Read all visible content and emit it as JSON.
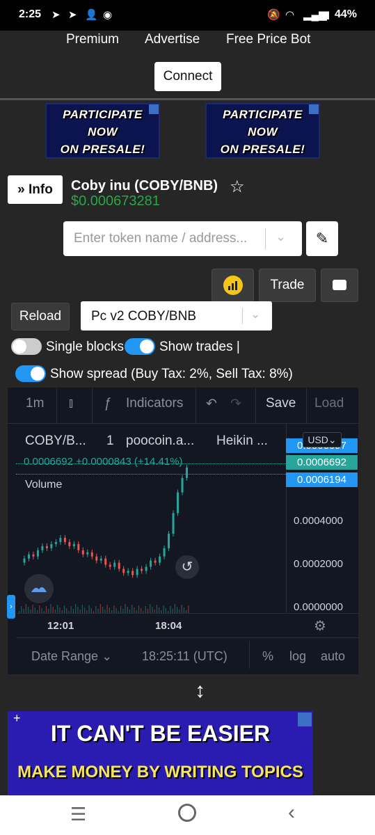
{
  "status_bar": {
    "time": "2:25",
    "battery": "44%"
  },
  "nav": {
    "premium": "Premium",
    "advertise": "Advertise",
    "free_price_bot": "Free Price Bot",
    "connect": "Connect"
  },
  "banners": {
    "presale_line1": "PARTICIPATE",
    "presale_line2": "NOW",
    "presale_line3": "ON PRESALE!",
    "big_line1": "IT CAN'T BE EASIER",
    "big_line2": "MAKE MONEY BY WRITING TOPICS"
  },
  "token": {
    "info_label": "Info",
    "name": "Coby inu (COBY/BNB)",
    "price": "$0.000673281"
  },
  "search": {
    "placeholder": "Enter token name / address..."
  },
  "toolbar": {
    "trade": "Trade",
    "reload": "Reload",
    "pair_select": "Pc v2 COBY/BNB"
  },
  "toggles": {
    "single_blocks": "Single blocks",
    "show_trades": "Show trades |",
    "show_spread": "Show spread (Buy Tax: 2%, Sell Tax: 8%)",
    "single_blocks_on": false,
    "show_trades_on": true,
    "show_spread_on": true
  },
  "chart": {
    "interval": "1m",
    "indicators": "Indicators",
    "save": "Save",
    "load": "Load",
    "symbol": "COBY/B...",
    "symbol_interval": "1",
    "source": "poocoin.a...",
    "chart_style": "Heikin ...",
    "currency": "USD",
    "ohlc_line": "0.0006692 +0.0000843 (+14.41%)",
    "volume_label": "Volume",
    "price_tags": [
      "0.0006697",
      "0.0006692",
      "0.0006194"
    ],
    "y_ticks": [
      "0.0004000",
      "0.0002000",
      "0.0000000"
    ],
    "x_ticks": [
      "12:01",
      "18:04"
    ],
    "date_range": "Date Range",
    "utc_time": "18:25:11 (UTC)",
    "percent": "%",
    "log": "log",
    "auto": "auto",
    "colors": {
      "up": "#26a69a",
      "down": "#ef5350",
      "tag_blue": "#2196f3",
      "tag_green": "#26a69a"
    }
  },
  "chart_data": {
    "type": "line",
    "title": "",
    "xlabel": "",
    "ylabel": "",
    "ylim": [
      0,
      0.00068
    ],
    "x_ticks": [
      "12:01",
      "18:04"
    ],
    "series": [
      {
        "values": [
          0.00021,
          0.00023,
          0.00025,
          0.00024,
          0.00027,
          0.00029,
          0.00028,
          0.0003,
          0.00031,
          0.00033,
          0.00031,
          0.00029,
          0.0003,
          0.00027,
          0.00025,
          0.00026,
          0.00024,
          0.00022,
          0.00023,
          0.0002,
          0.00019,
          0.00021,
          0.00018,
          0.00016,
          0.00017,
          0.00015,
          0.00018,
          0.00017,
          0.00019,
          0.00022,
          0.00021,
          0.00024,
          0.00028,
          0.00035,
          0.00045,
          0.00055,
          0.00062,
          0.00067
        ]
      }
    ]
  }
}
